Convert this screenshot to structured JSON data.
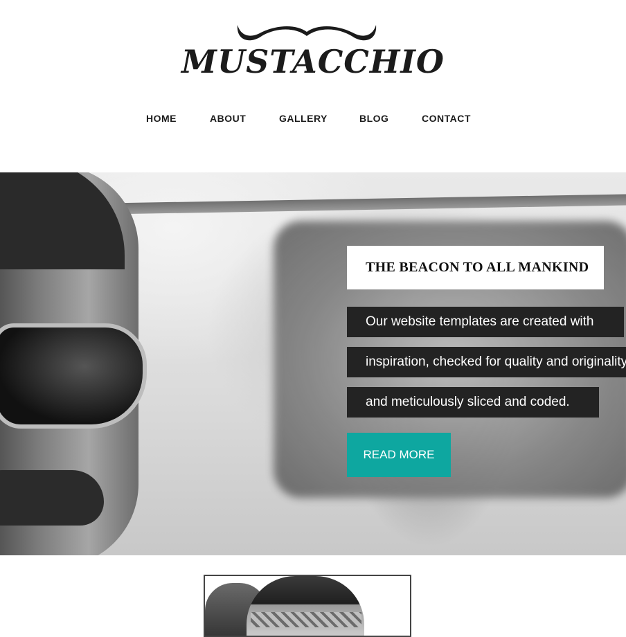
{
  "header": {
    "logo_text": "MUSTACCHIO",
    "nav": [
      {
        "label": "HOME"
      },
      {
        "label": "ABOUT"
      },
      {
        "label": "GALLERY"
      },
      {
        "label": "BLOG"
      },
      {
        "label": "CONTACT"
      }
    ]
  },
  "hero": {
    "title": "THE BEACON TO ALL MANKIND",
    "lines": [
      "Our website templates are created with",
      "inspiration, checked for quality and originality",
      "and meticulously sliced and coded."
    ],
    "button_label": "READ MORE",
    "accent_color": "#0ea7a0"
  }
}
